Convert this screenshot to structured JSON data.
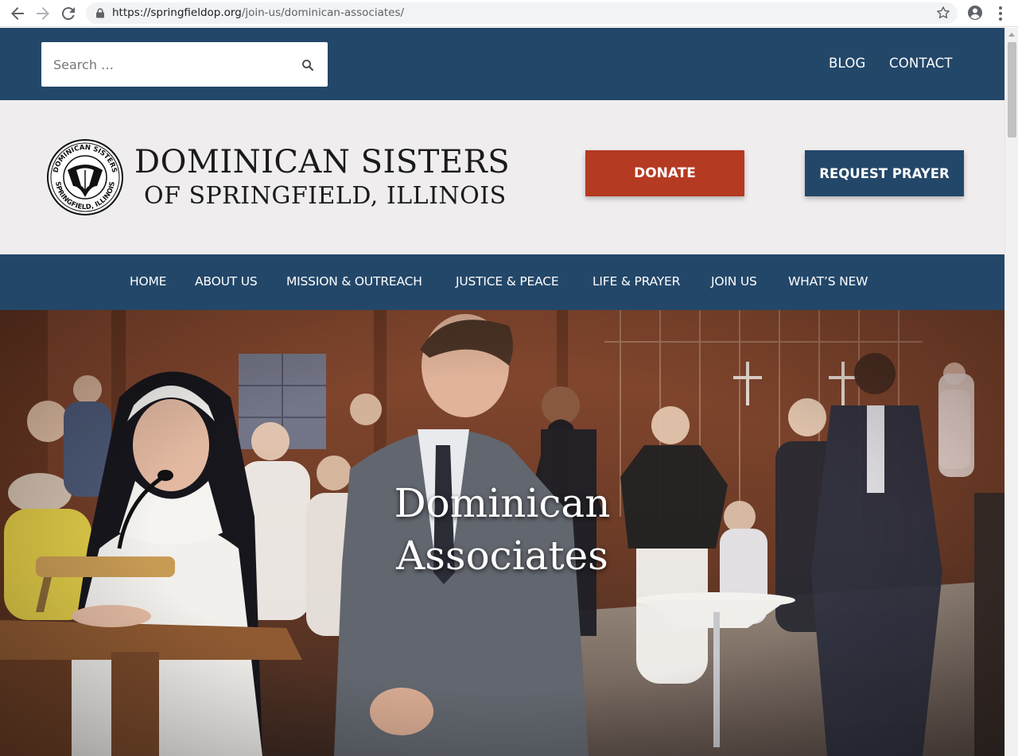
{
  "browser": {
    "url_domain": "https://springfieldop.org",
    "url_path": "/join-us/dominican-associates/"
  },
  "topbar": {
    "search_placeholder": "Search …",
    "links": [
      "BLOG",
      "CONTACT"
    ]
  },
  "header": {
    "logo_line1": "DOMINICAN SISTERS",
    "logo_line2": "OF SPRINGFIELD, ILLINOIS",
    "seal_text_top": "DOMINICAN SISTERS",
    "seal_text_bottom": "SPRINGFIELD, ILLINOIS",
    "donate_label": "DONATE",
    "prayer_label": "REQUEST PRAYER"
  },
  "nav": {
    "items": [
      "HOME",
      "ABOUT US",
      "MISSION & OUTREACH",
      "JUSTICE & PEACE",
      "LIFE & PRAYER",
      "JOIN US",
      "WHAT’S NEW"
    ]
  },
  "hero": {
    "title_line1": "Dominican",
    "title_line2": "Associates"
  },
  "colors": {
    "brand_navy": "#234769",
    "donate_red": "#b53a22",
    "header_bg": "#efedee"
  }
}
